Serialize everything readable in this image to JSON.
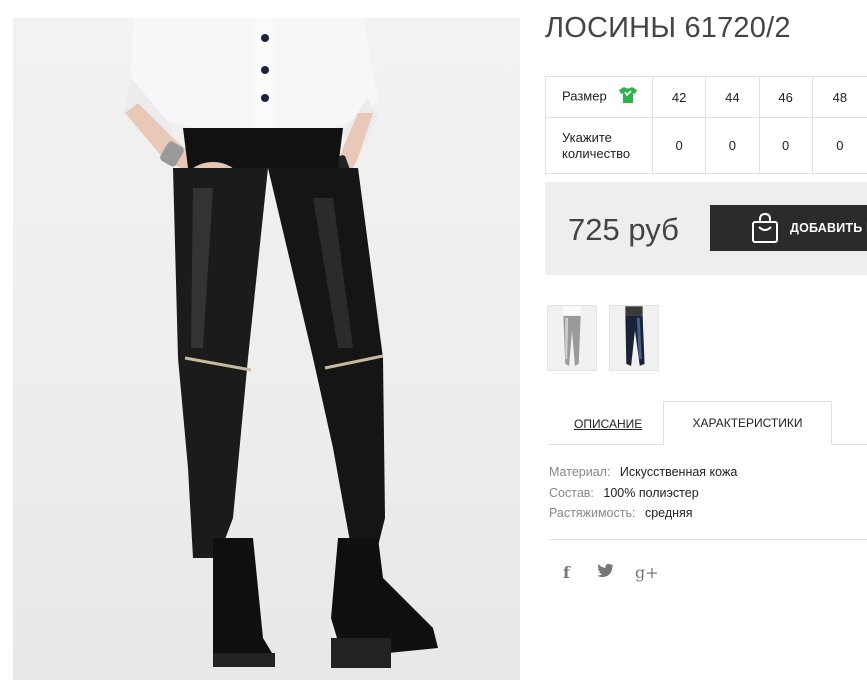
{
  "product": {
    "title": "ЛОСИНЫ 61720/2"
  },
  "sizes": {
    "size_label": "Размер",
    "size_icon": "tshirt-icon",
    "quantity_label_line1": "Укажите",
    "quantity_label_line2": "количество",
    "columns": [
      "42",
      "44",
      "46",
      "48"
    ],
    "quantities": [
      "0",
      "0",
      "0",
      "0"
    ]
  },
  "purchase": {
    "price": "725 руб",
    "add_button_label": "ДОБАВИТЬ В",
    "add_button_icon": "shopping-bag-icon"
  },
  "tabs": {
    "description": "ОПИСАНИЕ",
    "characteristics": "ХАРАКТЕРИСТИКИ"
  },
  "specs": [
    {
      "key": "Материал:",
      "value": "Искусственная кожа"
    },
    {
      "key": "Состав:",
      "value": "100% полиэстер"
    },
    {
      "key": "Растяжимость:",
      "value": "средняя"
    }
  ],
  "social": {
    "facebook": "f",
    "twitter_icon": "twitter-icon",
    "gplus": "g+"
  },
  "colors": {
    "button_bg": "#2b2b2b",
    "price_bg": "#eeeeee",
    "size_icon_green": "#2bb24c"
  }
}
